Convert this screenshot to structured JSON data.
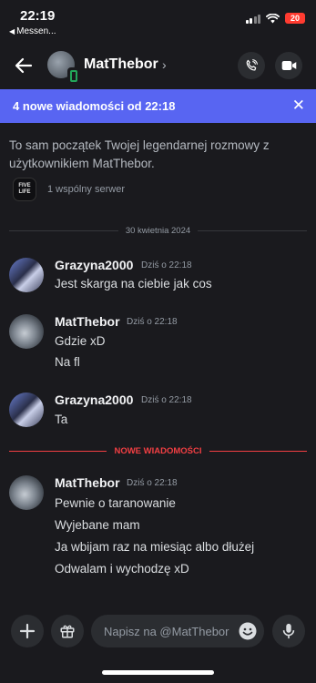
{
  "status": {
    "time": "22:19",
    "back_app": "Messen...",
    "battery": "20"
  },
  "header": {
    "title": "MatThebor",
    "chevron": "›"
  },
  "banner": {
    "text": "4 nowe wiadomości od 22:18",
    "close": "✕"
  },
  "intro": {
    "cut_text": "Ta",
    "text": "To sam początek Twojej legendarnej rozmowy z użytkownikiem MatThebor.",
    "mutual_servers": "1 wspólny serwer",
    "server_icon_text": "FIVE LIFE"
  },
  "dividers": {
    "date": "30 kwietnia 2024",
    "new_messages": "NOWE WIADOMOŚCI"
  },
  "messages": [
    {
      "author": "Grazyna2000",
      "time": "Dziś o 22:18",
      "lines": [
        "Jest skarga na ciebie jak cos"
      ]
    },
    {
      "author": "MatThebor",
      "time": "Dziś o 22:18",
      "lines": [
        "Gdzie xD",
        "Na fl"
      ]
    },
    {
      "author": "Grazyna2000",
      "time": "Dziś o 22:18",
      "lines": [
        "Ta"
      ]
    },
    {
      "author": "MatThebor",
      "time": "Dziś o 22:18",
      "lines": [
        "Pewnie o taranowanie",
        "Wyjebane mam",
        "Ja wbijam raz na miesiąc albo dłużej",
        "Odwalam i wychodzę xD"
      ]
    }
  ],
  "composer": {
    "placeholder": "Napisz na @MatThebor"
  },
  "colors": {
    "background": "#1a1a1e",
    "banner": "#5865f2",
    "new_divider": "#f23f43",
    "online": "#23a55a"
  },
  "icons": [
    "back-arrow-icon",
    "phone-icon",
    "video-camera-icon",
    "close-icon",
    "plus-icon",
    "gift-icon",
    "emoji-icon",
    "microphone-icon"
  ]
}
